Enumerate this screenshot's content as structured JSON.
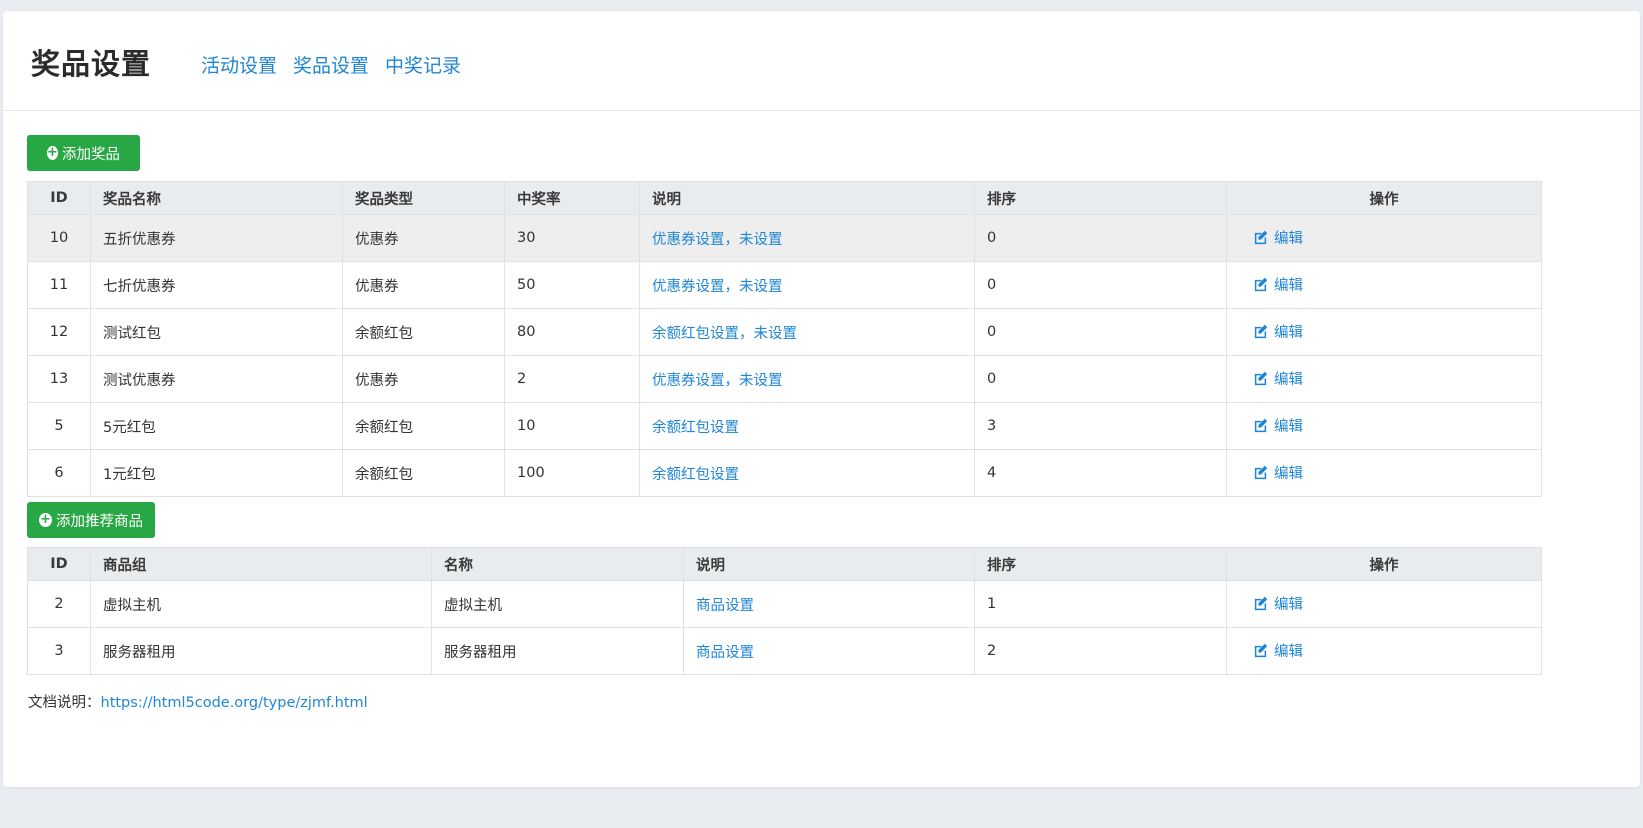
{
  "header": {
    "title": "奖品设置",
    "nav": [
      "活动设置",
      "奖品设置",
      "中奖记录"
    ]
  },
  "prizes": {
    "add_button": "添加奖品",
    "columns": [
      "ID",
      "奖品名称",
      "奖品类型",
      "中奖率",
      "说明",
      "排序",
      "操作"
    ],
    "rows": [
      {
        "id": "10",
        "name": "五折优惠券",
        "type": "优惠券",
        "rate": "30",
        "desc": "优惠券设置，未设置",
        "sort": "0",
        "action": "编辑"
      },
      {
        "id": "11",
        "name": "七折优惠券",
        "type": "优惠券",
        "rate": "50",
        "desc": "优惠券设置，未设置",
        "sort": "0",
        "action": "编辑"
      },
      {
        "id": "12",
        "name": "测试红包",
        "type": "余额红包",
        "rate": "80",
        "desc": "余额红包设置，未设置",
        "sort": "0",
        "action": "编辑"
      },
      {
        "id": "13",
        "name": "测试优惠券",
        "type": "优惠券",
        "rate": "2",
        "desc": "优惠券设置，未设置",
        "sort": "0",
        "action": "编辑"
      },
      {
        "id": "5",
        "name": "5元红包",
        "type": "余额红包",
        "rate": "10",
        "desc": "余额红包设置",
        "sort": "3",
        "action": "编辑"
      },
      {
        "id": "6",
        "name": "1元红包",
        "type": "余额红包",
        "rate": "100",
        "desc": "余额红包设置",
        "sort": "4",
        "action": "编辑"
      }
    ]
  },
  "products": {
    "add_button": "添加推荐商品",
    "columns": [
      "ID",
      "商品组",
      "名称",
      "说明",
      "排序",
      "操作"
    ],
    "rows": [
      {
        "id": "2",
        "group": "虚拟主机",
        "name": "虚拟主机",
        "desc": "商品设置",
        "sort": "1",
        "action": "编辑"
      },
      {
        "id": "3",
        "group": "服务器租用",
        "name": "服务器租用",
        "desc": "商品设置",
        "sort": "2",
        "action": "编辑"
      }
    ]
  },
  "doc": {
    "label": "文档说明：",
    "link": "https://html5code.org/type/zjmf.html"
  },
  "colors": {
    "accent": "#1f86d6",
    "button_green": "#28a745",
    "page_bg": "#e9ecf0"
  },
  "icons": {
    "add": "plus-circle-icon",
    "edit": "edit-icon"
  }
}
